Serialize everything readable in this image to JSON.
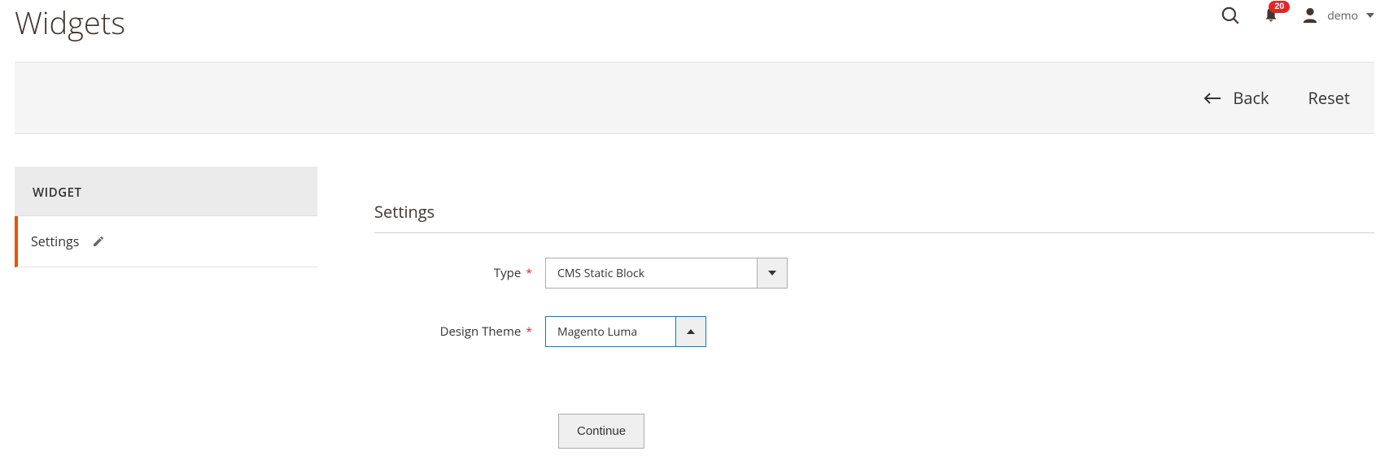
{
  "header": {
    "title": "Widgets",
    "notification_count": "20",
    "username": "demo"
  },
  "actions": {
    "back_label": "Back",
    "reset_label": "Reset"
  },
  "sidebar": {
    "group_label": "WIDGET",
    "items": [
      {
        "label": "Settings"
      }
    ]
  },
  "main": {
    "section_title": "Settings",
    "fields": {
      "type": {
        "label": "Type",
        "value": "CMS Static Block"
      },
      "design_theme": {
        "label": "Design Theme",
        "value": "Magento Luma"
      }
    },
    "continue_label": "Continue"
  }
}
